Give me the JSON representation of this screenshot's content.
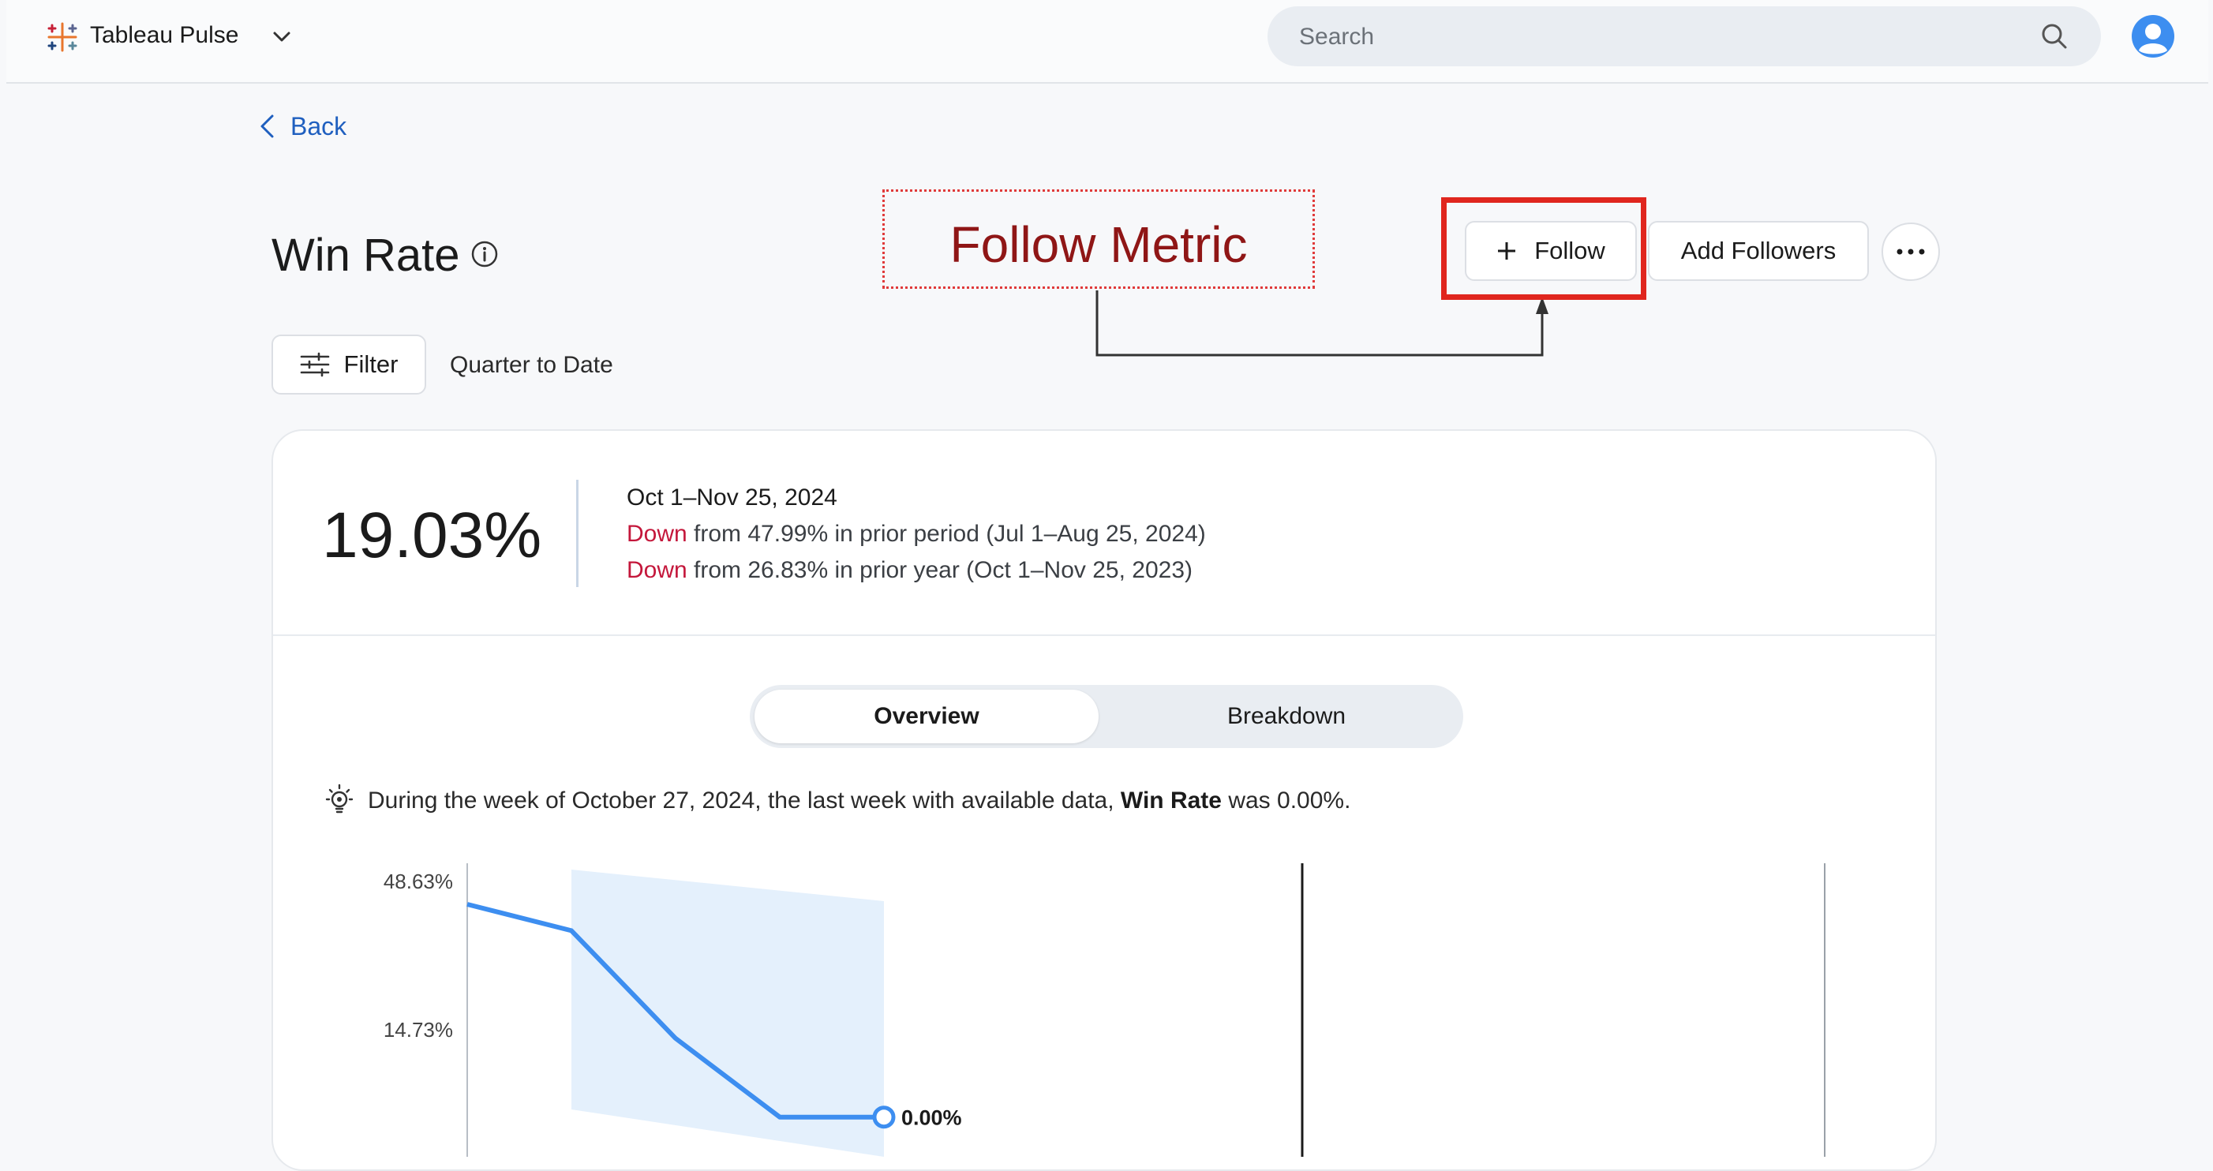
{
  "app": {
    "name": "Tableau Pulse"
  },
  "search": {
    "placeholder": "Search"
  },
  "nav": {
    "back_label": "Back"
  },
  "metric": {
    "title": "Win Rate",
    "value": "19.03%",
    "period": "Oct 1–Nov 25, 2024",
    "comparisons": [
      {
        "direction": "Down",
        "text": " from 47.99% in prior period (Jul 1–Aug 25, 2024)"
      },
      {
        "direction": "Down",
        "text": " from 26.83% in prior year (Oct 1–Nov 25, 2023)"
      }
    ]
  },
  "annotation": {
    "label": "Follow Metric"
  },
  "actions": {
    "follow_label": "Follow",
    "add_followers_label": "Add Followers"
  },
  "filter": {
    "label": "Filter",
    "date_range": "Quarter to Date"
  },
  "tabs": [
    {
      "label": "Overview",
      "active": true
    },
    {
      "label": "Breakdown",
      "active": false
    }
  ],
  "insight": {
    "prefix": "During the week of October 27, 2024, the last week with available data, ",
    "metric": "Win Rate",
    "suffix": " was 0.00%."
  },
  "icons": [
    "tableau-logo-icon",
    "chevron-down-icon",
    "search-icon",
    "user-avatar-icon",
    "chevron-left-icon",
    "info-icon",
    "plus-icon",
    "more-icon",
    "filter-icon",
    "lightbulb-icon"
  ],
  "colors": {
    "accent": "#1f5fbf",
    "down": "#c4173b",
    "annotation": "#8f1616",
    "highlight": "#e0261e",
    "line": "#3d8ef0",
    "band": "#e4f0fc"
  },
  "chart_data": {
    "type": "line",
    "y_tick_labels": [
      "48.63%",
      "14.73%"
    ],
    "series": [
      {
        "values": [
          48.63,
          42.6,
          18.0,
          0.0,
          0.0
        ]
      }
    ],
    "end_label": "0.00%",
    "grid": false
  }
}
